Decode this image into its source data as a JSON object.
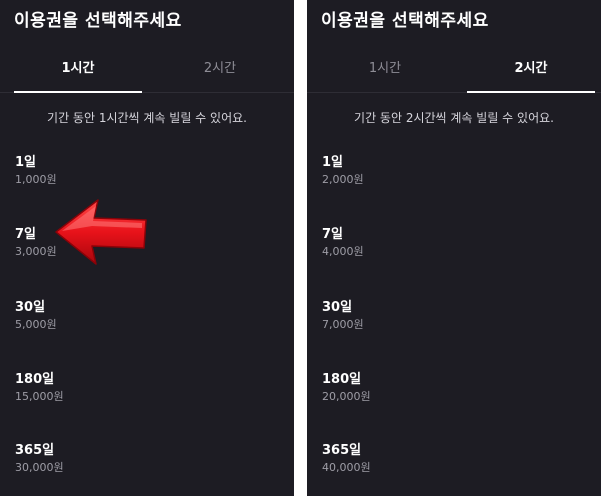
{
  "left_panel": {
    "title": "이용권을 선택해주세요",
    "tabs": [
      {
        "label": "1시간",
        "active": true
      },
      {
        "label": "2시간",
        "active": false
      }
    ],
    "notice": "기간 동안 1시간씩 계속 빌릴 수 있어요.",
    "plans": [
      {
        "name": "1일",
        "price": "1,000원"
      },
      {
        "name": "7일",
        "price": "3,000원"
      },
      {
        "name": "30일",
        "price": "5,000원"
      },
      {
        "name": "180일",
        "price": "15,000원"
      },
      {
        "name": "365일",
        "price": "30,000원"
      }
    ]
  },
  "right_panel": {
    "title": "이용권을 선택해주세요",
    "tabs": [
      {
        "label": "1시간",
        "active": false
      },
      {
        "label": "2시간",
        "active": true
      }
    ],
    "notice": "기간 동안 2시간씩 계속 빌릴 수 있어요.",
    "plans": [
      {
        "name": "1일",
        "price": "2,000원"
      },
      {
        "name": "7일",
        "price": "4,000원"
      },
      {
        "name": "30일",
        "price": "7,000원"
      },
      {
        "name": "180일",
        "price": "20,000원"
      },
      {
        "name": "365일",
        "price": "40,000원"
      }
    ]
  },
  "colors": {
    "panel_bg": "#1d1c23",
    "text_primary": "#ffffff",
    "text_secondary": "#9e9da6",
    "arrow": "#e8121a"
  },
  "annotation": {
    "icon": "red-arrow-icon",
    "points_to": "7일"
  }
}
